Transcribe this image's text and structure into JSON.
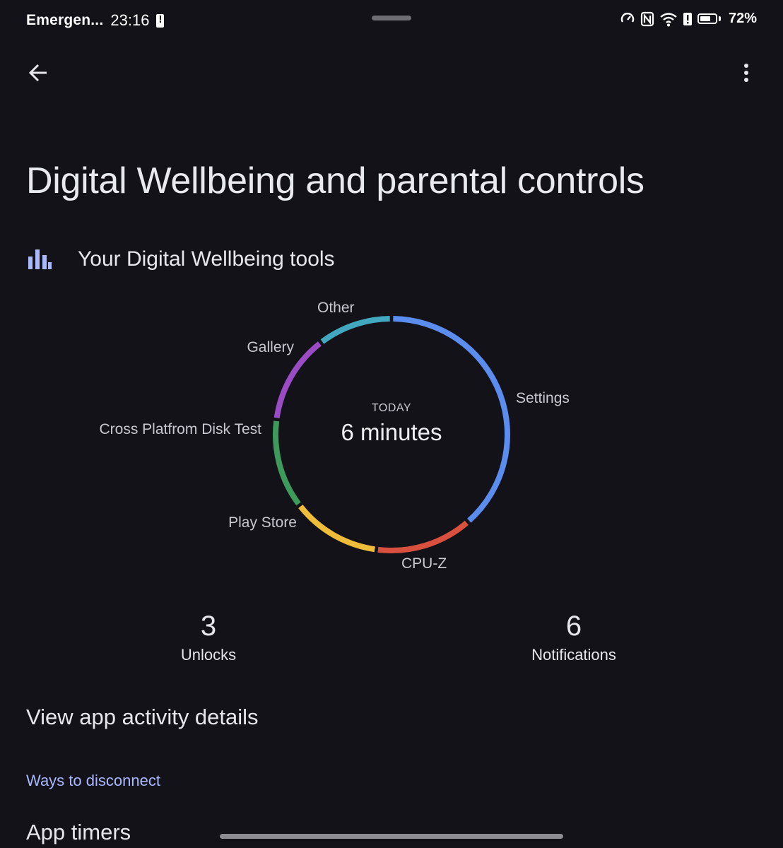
{
  "status_bar": {
    "carrier": "Emergen...",
    "time": "23:16",
    "battery_percent": "72%",
    "battery_level": 0.72
  },
  "page": {
    "title": "Digital Wellbeing and parental controls"
  },
  "section": {
    "title": "Your Digital Wellbeing tools",
    "icon": "bar-chart-icon"
  },
  "chart_data": {
    "type": "pie",
    "center_caption": "TODAY",
    "center_value": "6 minutes",
    "slices": [
      {
        "label": "Settings",
        "value": 37,
        "color": "#5b8def"
      },
      {
        "label": "CPU-Z",
        "value": 13,
        "color": "#d9503f"
      },
      {
        "label": "Play Store",
        "value": 12,
        "color": "#f0bd3a"
      },
      {
        "label": "Cross Platfrom Disk Test",
        "value": 12,
        "color": "#3d9a5a"
      },
      {
        "label": "Gallery",
        "value": 12,
        "color": "#9b4cc4"
      },
      {
        "label": "Other",
        "value": 10,
        "color": "#42a8c0"
      }
    ]
  },
  "stats": {
    "unlocks_count": "3",
    "unlocks_label": "Unlocks",
    "notifications_count": "6",
    "notifications_label": "Notifications"
  },
  "links": {
    "view_activity": "View app activity details",
    "ways_to_disconnect": "Ways to disconnect",
    "app_timers": "App timers"
  },
  "colors": {
    "background": "#121218",
    "accent": "#a9b8ff"
  }
}
